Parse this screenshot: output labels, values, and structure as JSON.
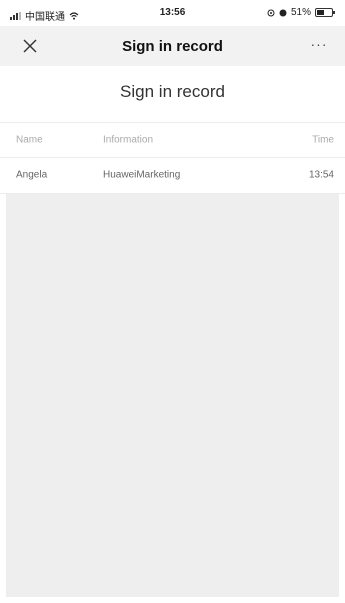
{
  "status_bar": {
    "carrier": "中国联通",
    "wifi_icon": "wifi-icon",
    "time": "13:56",
    "battery_percent": "51%",
    "battery_level": 0.51
  },
  "nav": {
    "title": "Sign in record",
    "close_icon": "close-icon",
    "more_label": "···"
  },
  "page": {
    "heading": "Sign in record",
    "table": {
      "columns": [
        "Name",
        "Information",
        "Time"
      ],
      "rows": [
        {
          "name": "Angela",
          "information": "HuaweiMarketing",
          "time": "13:54"
        }
      ]
    }
  },
  "colors": {
    "nav_background": "#f2f2f2",
    "empty_background": "#eeeeee",
    "header_text": "#aaaaaa"
  }
}
